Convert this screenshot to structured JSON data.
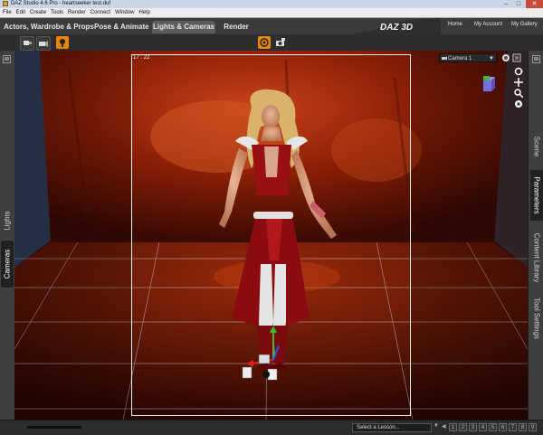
{
  "window": {
    "title": "DAZ Studio 4.6 Pro - heartseeker test.duf"
  },
  "menu": [
    "File",
    "Edit",
    "Create",
    "Tools",
    "Render",
    "Connect",
    "Window",
    "Help"
  ],
  "tabs": [
    {
      "label": "Actors, Wardrobe & Props",
      "active": false
    },
    {
      "label": "Pose & Animate",
      "active": false
    },
    {
      "label": "Lights & Cameras",
      "active": true
    },
    {
      "label": "Render",
      "active": false
    }
  ],
  "header_links": [
    "Home",
    "My Account",
    "My Gallery"
  ],
  "logo": "DAZ 3D",
  "left_panel": {
    "tabs": [
      "Lights",
      "Cameras"
    ]
  },
  "right_panel": {
    "tabs": [
      "Scene",
      "Parameters",
      "Content Library",
      "Tool Settings"
    ]
  },
  "viewport": {
    "aspect_label": "17 : 22",
    "camera": "Camera 1"
  },
  "bottom": {
    "lesson_placeholder": "Select a Lesson...",
    "pages": [
      "1",
      "2",
      "3",
      "4",
      "5",
      "6",
      "7",
      "8",
      "9"
    ]
  },
  "colors": {
    "accent_orange": "#e8860c",
    "active_tab": "#5b5b5b",
    "viewport_red": "#8a1e06",
    "view_cube": "#7a6fe0"
  },
  "icons": [
    "app-icon",
    "minimize-icon",
    "maximize-icon",
    "close-icon",
    "orbit-icon",
    "pan-icon",
    "zoom-icon",
    "rotate-icon",
    "view-cube-icon",
    "camera-dropdown-icon"
  ]
}
